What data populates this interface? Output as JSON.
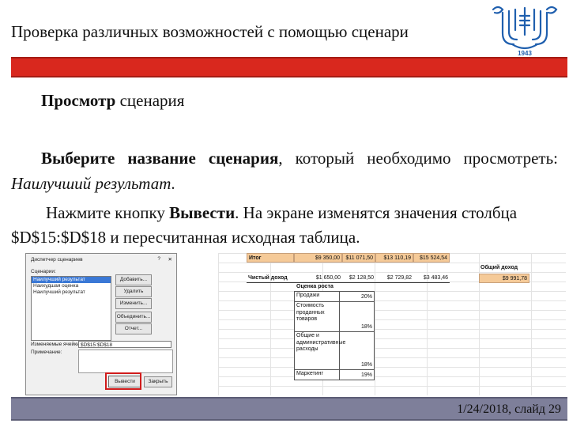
{
  "header": {
    "title": "Проверка различных возможностей с помощью сценари",
    "logo_year": "1943"
  },
  "section": {
    "heading_bold": "Просмотр",
    "heading_rest": " сценария"
  },
  "para1": {
    "bold": "Выберите название сценария",
    "text": ", который необходимо просмотреть: ",
    "italic": "Наилучший результат",
    "end": "."
  },
  "para2": {
    "pre": "Нажмите кнопку ",
    "bold": "Вывести",
    "text": ". На экране изменятся значения столбца $D$15:$D$18 и пересчитанная исходная таблица."
  },
  "dialog": {
    "title": "Диспетчер сценариев",
    "help": "?",
    "close": "✕",
    "scenarios_label": "Сценарии:",
    "scenarios": [
      "Наилучший результат",
      "Наихудшая оценка",
      "Наилучший результат"
    ],
    "buttons": {
      "add": "Добавить...",
      "delete": "Удалить",
      "edit": "Изменить...",
      "merge": "Объединить...",
      "summary": "Отчет..."
    },
    "changing_cells_label": "Изменяемые ячейки:",
    "changing_cells_value": "$D$15:$D$18",
    "comment_label": "Примечание:",
    "show_button": "Вывести",
    "close_button": "Закрыть"
  },
  "sheet": {
    "row1": {
      "label": "Итог",
      "values": [
        "$9 350,00",
        "$11 071,50",
        "$13 110,19",
        "$15 524,54"
      ]
    },
    "row2": {
      "label": "Чистый доход",
      "values": [
        "$1 650,00",
        "$2 128,50",
        "$2 729,82",
        "$3 483,46"
      ]
    },
    "total_label": "Общий доход",
    "total_value": "$9 991,78",
    "growth": {
      "title": "Оценка роста",
      "rows": [
        {
          "label": "Продажи",
          "value": "20%"
        },
        {
          "label": "Стоимость проданных товаров",
          "value": "18%"
        },
        {
          "label": "Общие и административные расходы",
          "value": "18%"
        },
        {
          "label": "Маркетинг",
          "value": "19%"
        }
      ]
    }
  },
  "footer": {
    "text": "1/24/2018, слайд 29"
  },
  "colors": {
    "red_bar": "#d9281e",
    "footer_bar": "#7e7f9a",
    "logo_blue": "#1f5fae",
    "cell_orange": "#f5ca98"
  }
}
